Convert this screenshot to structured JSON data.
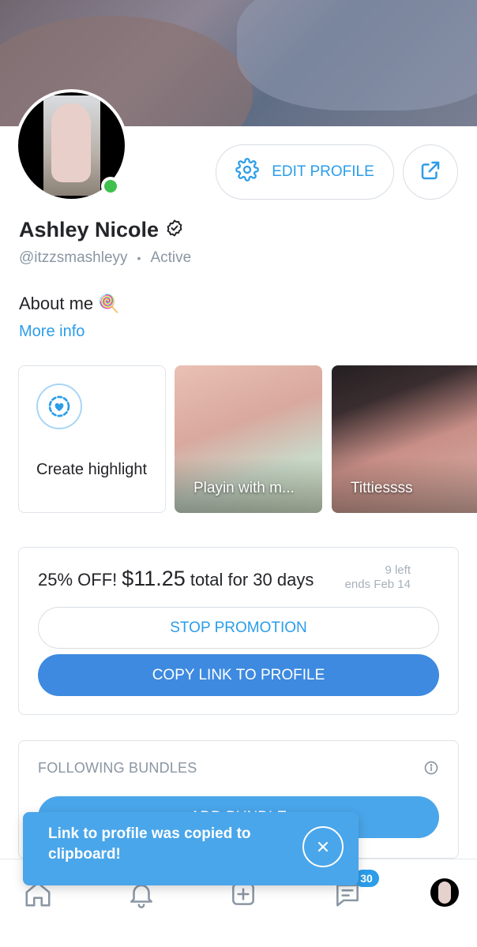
{
  "profile": {
    "name": "Ashley Nicole",
    "handle": "@itzzsmashleyy",
    "separator": "•",
    "status": "Active",
    "edit_label": "EDIT PROFILE",
    "about_label": "About me",
    "about_emoji": "🍭",
    "more_info": "More info"
  },
  "highlights": [
    {
      "label": "Create highlight",
      "icon": "story-add-icon"
    },
    {
      "caption": "Playin with m..."
    },
    {
      "caption": "Tittiessss"
    }
  ],
  "promotion": {
    "off": "25% OFF!",
    "price": "$11.25",
    "total": "total for 30 days",
    "left": "9 left",
    "ends": "ends Feb 14",
    "stop_label": "STOP PROMOTION",
    "copy_label": "COPY LINK TO PROFILE"
  },
  "bundles": {
    "title": "FOLLOWING BUNDLES",
    "add_label": "ADD BUNDLE"
  },
  "nav": {
    "items": [
      "home-icon",
      "bell-icon",
      "plus-square-icon",
      "chat-icon",
      "profile-avatar"
    ],
    "messages_badge": "30"
  },
  "toast": {
    "message": "Link to profile was copied to clipboard!"
  },
  "colors": {
    "accent": "#2b9de9",
    "primary_button": "#3d8ae0",
    "toast": "#4aa6ea",
    "online": "#3fc04f",
    "muted": "#8a96a3"
  }
}
